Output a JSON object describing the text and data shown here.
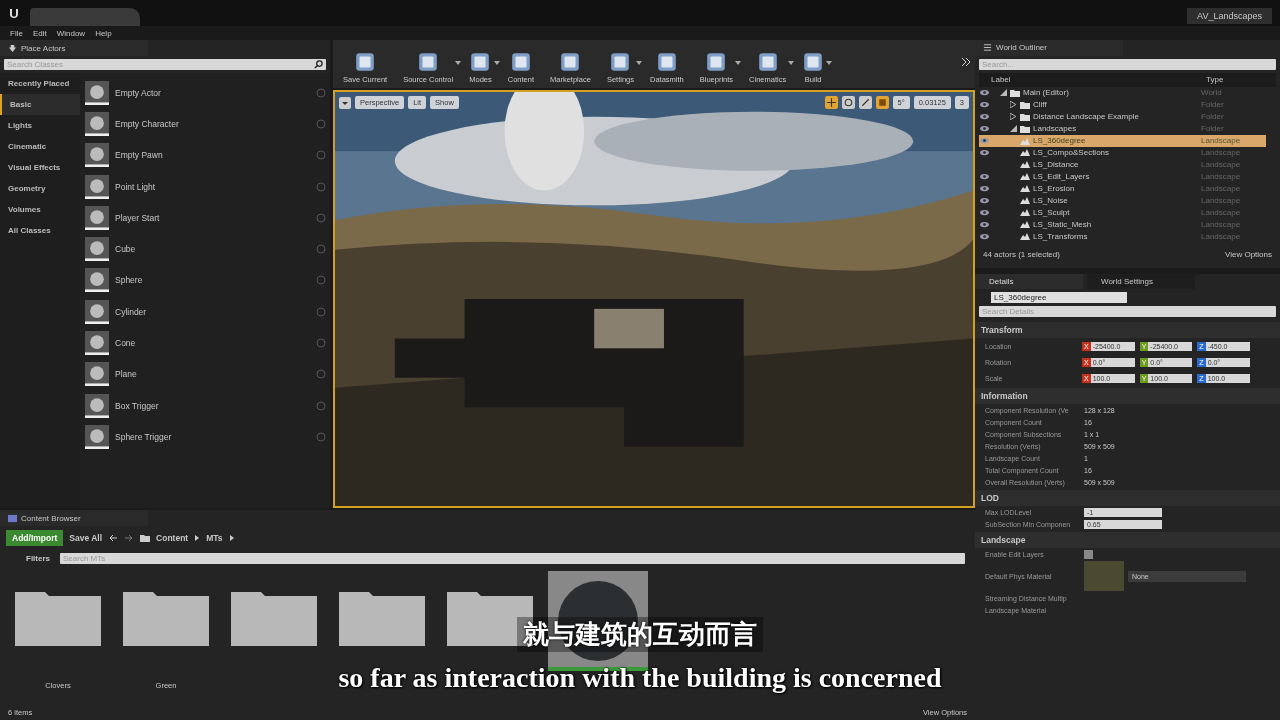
{
  "window": {
    "project": "AV_Landscapes"
  },
  "menu": [
    "File",
    "Edit",
    "Window",
    "Help"
  ],
  "place_actors": {
    "title": "Place Actors",
    "search": {
      "placeholder": "Search Classes"
    },
    "categories": [
      {
        "label": "Recently Placed",
        "selected": false
      },
      {
        "label": "Basic",
        "selected": true
      },
      {
        "label": "Lights",
        "selected": false
      },
      {
        "label": "Cinematic",
        "selected": false
      },
      {
        "label": "Visual Effects",
        "selected": false
      },
      {
        "label": "Geometry",
        "selected": false
      },
      {
        "label": "Volumes",
        "selected": false
      },
      {
        "label": "All Classes",
        "selected": false
      }
    ],
    "items": [
      "Empty Actor",
      "Empty Character",
      "Empty Pawn",
      "Point Light",
      "Player Start",
      "Cube",
      "Sphere",
      "Cylinder",
      "Cone",
      "Plane",
      "Box Trigger",
      "Sphere Trigger"
    ]
  },
  "toolbar": [
    {
      "label": "Save Current",
      "dropdown": false
    },
    {
      "label": "Source Control",
      "dropdown": true
    },
    {
      "label": "Modes",
      "dropdown": true
    },
    {
      "label": "Content",
      "dropdown": false
    },
    {
      "label": "Marketplace",
      "dropdown": false
    },
    {
      "label": "Settings",
      "dropdown": true
    },
    {
      "label": "Datasmith",
      "dropdown": false
    },
    {
      "label": "Blueprints",
      "dropdown": true
    },
    {
      "label": "Cinematics",
      "dropdown": true
    },
    {
      "label": "Build",
      "dropdown": true
    }
  ],
  "viewport": {
    "kind": "picture",
    "view": "Perspective",
    "lighting": "Lit",
    "show": "Show",
    "angle_snap": "5°",
    "scale_snap": "0.03125",
    "camera_speed": "3"
  },
  "world_outliner": {
    "title": "World Outliner",
    "search": {
      "placeholder": "Search..."
    },
    "columns": [
      "Label",
      "Type"
    ],
    "rows": [
      {
        "label": "Main (Editor)",
        "type": "World",
        "visible": true,
        "selected": false,
        "expanded": true,
        "children": [
          {
            "label": "Cliff",
            "type": "Folder",
            "visible": true,
            "selected": false,
            "expanded": false
          },
          {
            "label": "Distance Landscape Example",
            "type": "Folder",
            "visible": true,
            "selected": false,
            "expanded": false
          },
          {
            "label": "Landscapes",
            "type": "Folder",
            "visible": true,
            "selected": false,
            "expanded": true,
            "children": [
              {
                "label": "LS_360degree",
                "type": "Landscape",
                "visible": true,
                "selected": true
              },
              {
                "label": "LS_Compo&Sections",
                "type": "Landscape",
                "visible": true,
                "selected": false
              },
              {
                "label": "LS_Distance",
                "type": "Landscape",
                "visible": false,
                "selected": false
              },
              {
                "label": "LS_Edit_Layers",
                "type": "Landscape",
                "visible": true,
                "selected": false
              },
              {
                "label": "LS_Erosion",
                "type": "Landscape",
                "visible": true,
                "selected": false
              },
              {
                "label": "LS_Noise",
                "type": "Landscape",
                "visible": true,
                "selected": false
              },
              {
                "label": "LS_Sculpt",
                "type": "Landscape",
                "visible": true,
                "selected": false
              },
              {
                "label": "LS_Static_Mesh",
                "type": "Landscape",
                "visible": true,
                "selected": false
              },
              {
                "label": "LS_Transforms",
                "type": "Landscape",
                "visible": true,
                "selected": false
              }
            ]
          }
        ]
      }
    ],
    "status": "44 actors (1 selected)",
    "view_options": "View Options"
  },
  "details": {
    "tabs": [
      {
        "label": "Details",
        "selected": true
      },
      {
        "label": "World Settings",
        "selected": false
      }
    ],
    "name": "LS_360degree",
    "search": {
      "placeholder": "Search Details"
    },
    "transform": {
      "title": "Transform",
      "rows": [
        {
          "label": "Location",
          "fields": [
            {
              "axis": "X",
              "value": "-25400.0"
            },
            {
              "axis": "Y",
              "value": "-25400.0"
            },
            {
              "axis": "Z",
              "value": "-450.0"
            }
          ]
        },
        {
          "label": "Rotation",
          "fields": [
            {
              "axis": "X",
              "value": "0.0°"
            },
            {
              "axis": "Y",
              "value": "0.0°"
            },
            {
              "axis": "Z",
              "value": "0.0°"
            }
          ]
        },
        {
          "label": "Scale",
          "fields": [
            {
              "axis": "X",
              "value": "100.0"
            },
            {
              "axis": "Y",
              "value": "100.0"
            },
            {
              "axis": "Z",
              "value": "100.0"
            }
          ]
        }
      ]
    },
    "information": {
      "title": "Information",
      "rows": [
        {
          "label": "Component Resolution (Ve",
          "value": "128 x 128"
        },
        {
          "label": "Component Count",
          "value": "16"
        },
        {
          "label": "Component Subsections",
          "value": "1 x 1"
        },
        {
          "label": "Resolution (Verts)",
          "value": "509 x 509"
        },
        {
          "label": "Landscape Count",
          "value": "1"
        },
        {
          "label": "Total Component Count",
          "value": "16"
        },
        {
          "label": "Overall Resolution (Verts)",
          "value": "509 x 509"
        }
      ]
    },
    "lod": {
      "title": "LOD",
      "rows": [
        {
          "label": "Max LODLevel",
          "value": "-1"
        },
        {
          "label": "SubSection Min Componen",
          "value": "0.65"
        }
      ]
    },
    "landscape": {
      "title": "Landscape",
      "enable_edit_layers": {
        "label": "Enable Edit Layers",
        "checked": false
      },
      "phys_material": {
        "label": "Default Phys Material",
        "value": "None"
      },
      "streaming": {
        "label": "Streaming Distance Multip"
      },
      "material": {
        "label": "Landscape Material"
      }
    }
  },
  "content_browser": {
    "title": "Content Browser",
    "add_import": "Add/Import",
    "save_all": "Save All",
    "path": [
      "Content",
      "MTs"
    ],
    "filters": "Filters",
    "search": {
      "placeholder": "Search MTs"
    },
    "items": [
      {
        "kind": "folder",
        "label": "Clovers"
      },
      {
        "kind": "folder",
        "label": "Green"
      },
      {
        "kind": "folder"
      },
      {
        "kind": "folder"
      },
      {
        "kind": "folder"
      },
      {
        "kind": "material"
      }
    ],
    "count": "6 items",
    "view_options": "View Options"
  },
  "subtitles": {
    "chinese": "就与建筑的互动而言",
    "english": "so far as interaction with the building is concerned"
  }
}
